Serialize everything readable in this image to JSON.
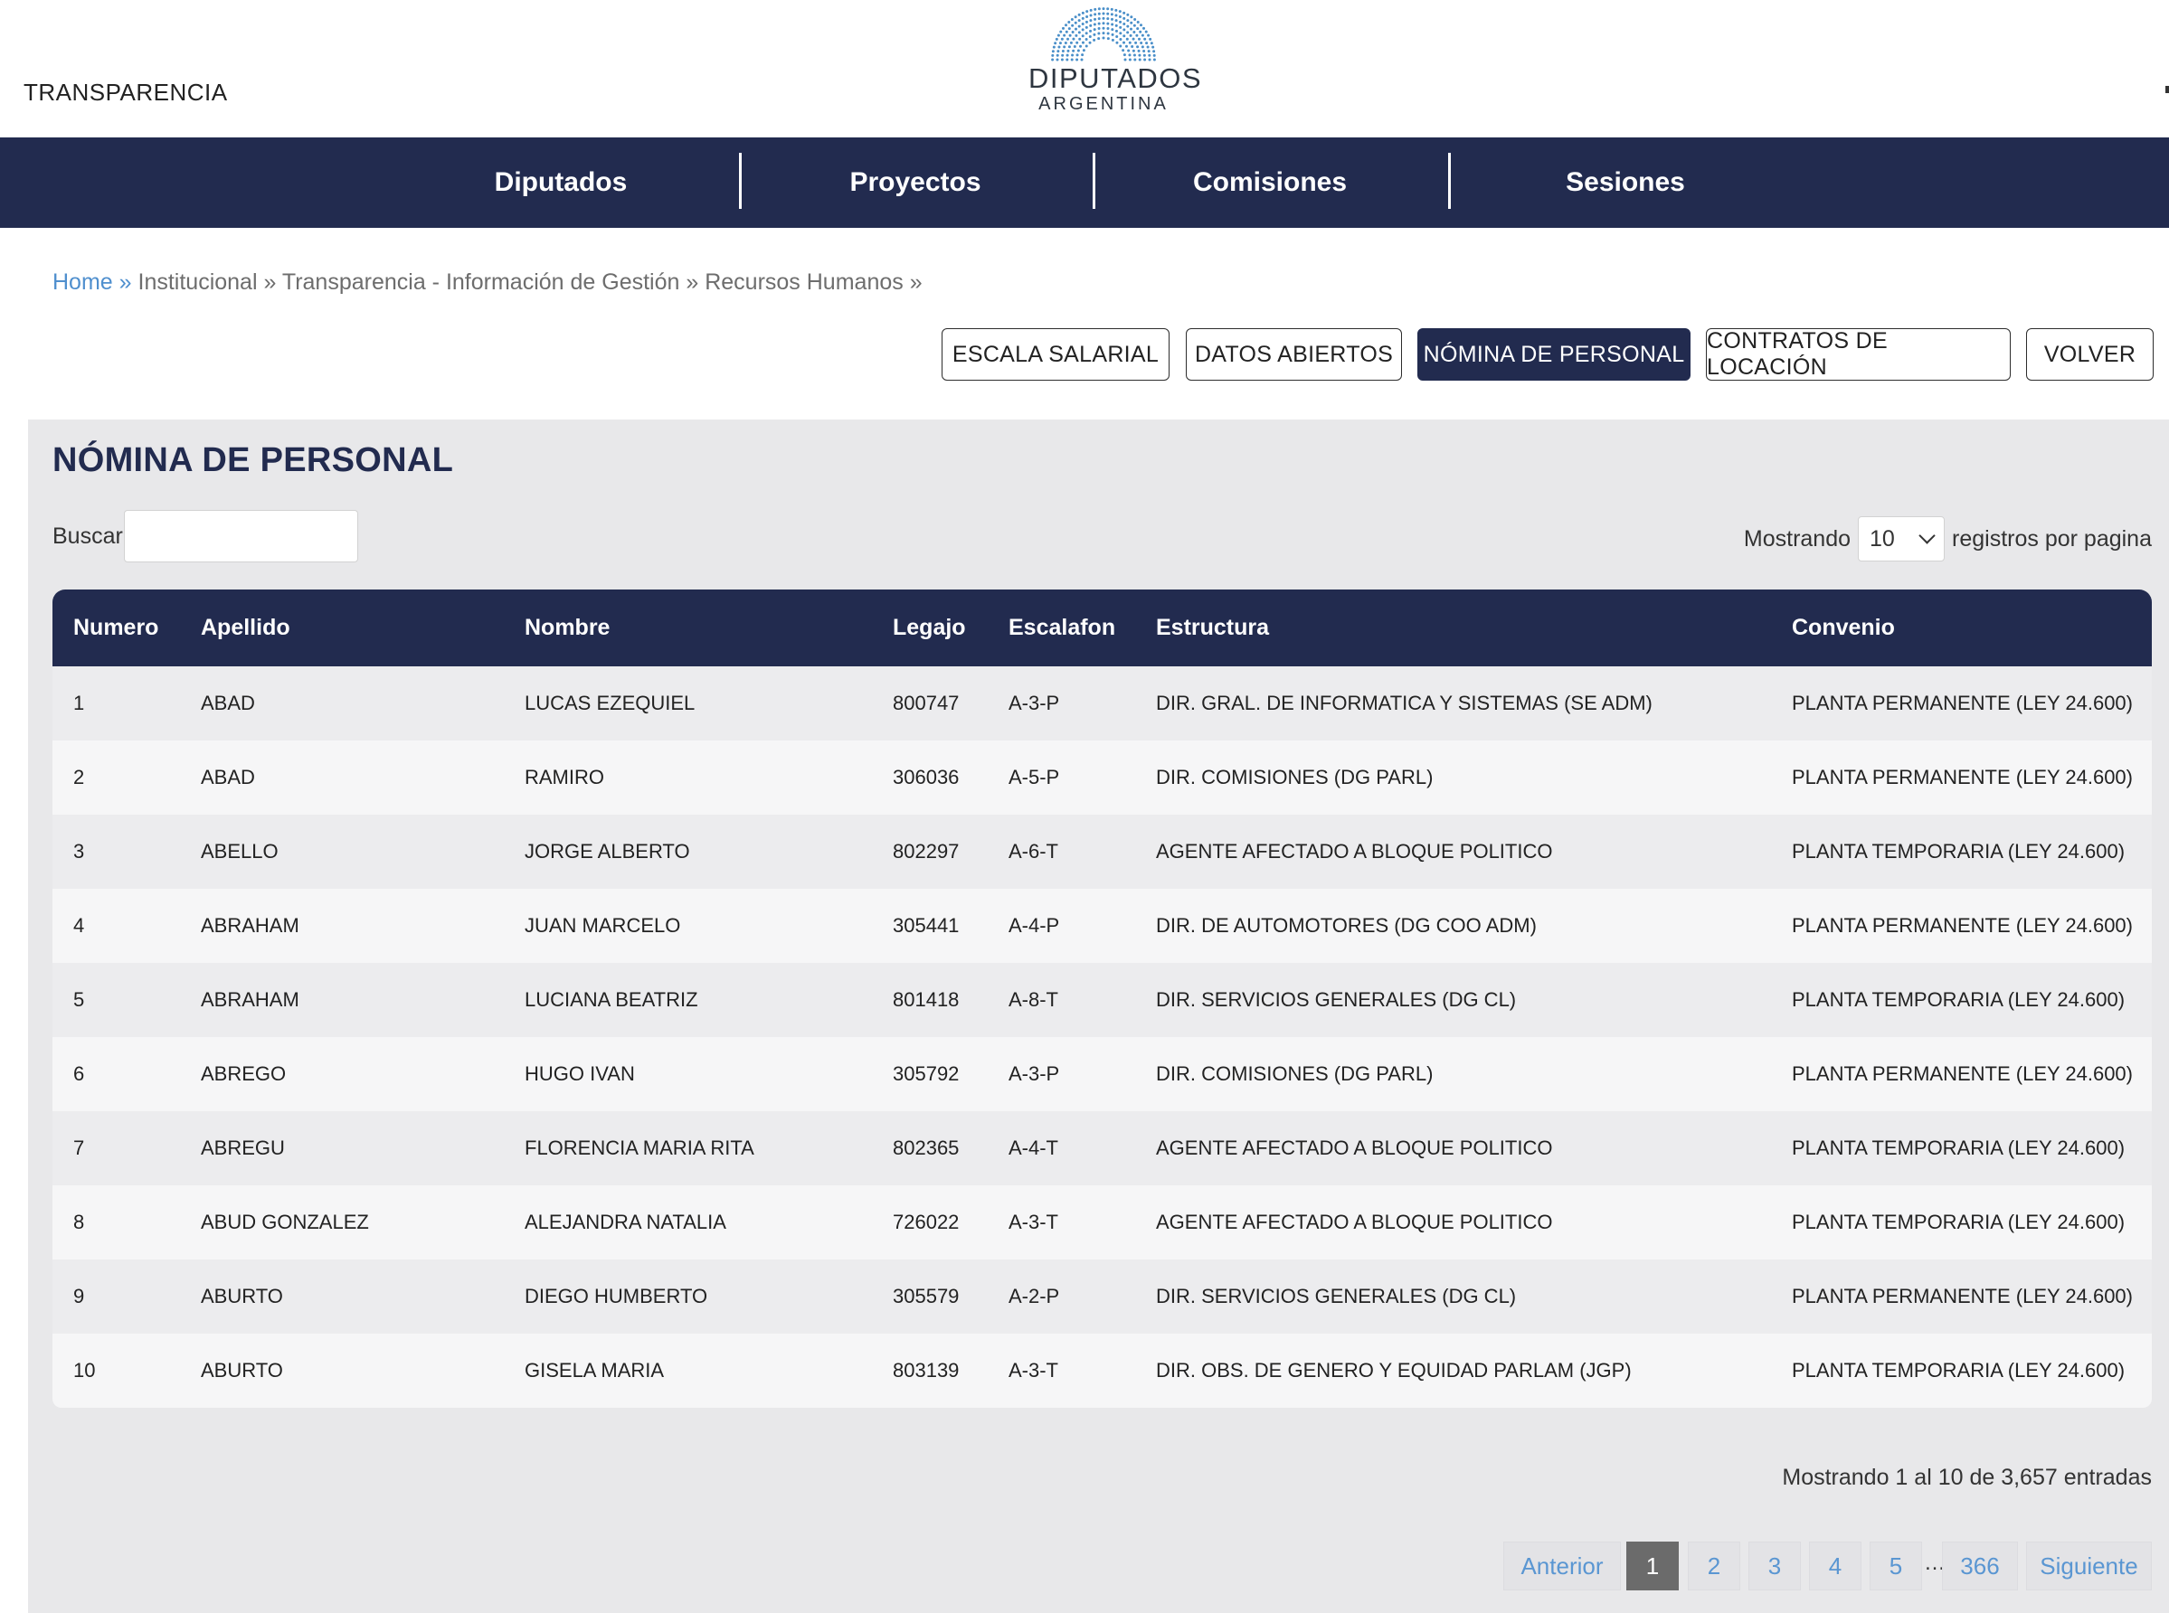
{
  "header": {
    "section_label": "TRANSPARENCIA",
    "logo_name": "DIPUTADOS",
    "logo_country": "ARGENTINA",
    "logo_icon": "hemicycle-seats-icon"
  },
  "nav": {
    "items": [
      "Diputados",
      "Proyectos",
      "Comisiones",
      "Sesiones"
    ]
  },
  "breadcrumb": {
    "home": "Home »",
    "rest": " Institucional » Transparencia - Información de Gestión » Recursos Humanos »"
  },
  "actions": {
    "escala": "ESCALA SALARIAL",
    "datos": "DATOS ABIERTOS",
    "nomina": "NÓMINA DE PERSONAL",
    "contratos": "CONTRATOS DE LOCACIÓN",
    "volver": "VOLVER"
  },
  "panel": {
    "title": "NÓMINA DE PERSONAL",
    "search_label": "Buscar:",
    "search_value": "",
    "length_prefix": "Mostrando",
    "length_value": "10",
    "length_suffix": "registros por pagina"
  },
  "table": {
    "columns": [
      "Numero",
      "Apellido",
      "Nombre",
      "Legajo",
      "Escalafon",
      "Estructura",
      "Convenio"
    ],
    "rows": [
      [
        "1",
        "ABAD",
        "LUCAS EZEQUIEL",
        "800747",
        "A-3-P",
        "DIR. GRAL. DE INFORMATICA Y SISTEMAS (SE ADM)",
        "PLANTA PERMANENTE (LEY 24.600)"
      ],
      [
        "2",
        "ABAD",
        "RAMIRO",
        "306036",
        "A-5-P",
        "DIR. COMISIONES (DG PARL)",
        "PLANTA PERMANENTE (LEY 24.600)"
      ],
      [
        "3",
        "ABELLO",
        "JORGE ALBERTO",
        "802297",
        "A-6-T",
        "AGENTE AFECTADO A BLOQUE POLITICO",
        "PLANTA TEMPORARIA (LEY 24.600)"
      ],
      [
        "4",
        "ABRAHAM",
        "JUAN MARCELO",
        "305441",
        "A-4-P",
        "DIR. DE AUTOMOTORES (DG COO ADM)",
        "PLANTA PERMANENTE (LEY 24.600)"
      ],
      [
        "5",
        "ABRAHAM",
        "LUCIANA BEATRIZ",
        "801418",
        "A-8-T",
        "DIR. SERVICIOS GENERALES (DG CL)",
        "PLANTA TEMPORARIA (LEY 24.600)"
      ],
      [
        "6",
        "ABREGO",
        "HUGO IVAN",
        "305792",
        "A-3-P",
        "DIR. COMISIONES (DG PARL)",
        "PLANTA PERMANENTE (LEY 24.600)"
      ],
      [
        "7",
        "ABREGU",
        "FLORENCIA MARIA RITA",
        "802365",
        "A-4-T",
        "AGENTE AFECTADO A BLOQUE POLITICO",
        "PLANTA TEMPORARIA (LEY 24.600)"
      ],
      [
        "8",
        "ABUD GONZALEZ",
        "ALEJANDRA NATALIA",
        "726022",
        "A-3-T",
        "AGENTE AFECTADO A BLOQUE POLITICO",
        "PLANTA TEMPORARIA (LEY 24.600)"
      ],
      [
        "9",
        "ABURTO",
        "DIEGO HUMBERTO",
        "305579",
        "A-2-P",
        "DIR. SERVICIOS GENERALES (DG CL)",
        "PLANTA PERMANENTE (LEY 24.600)"
      ],
      [
        "10",
        "ABURTO",
        "GISELA MARIA",
        "803139",
        "A-3-T",
        "DIR. OBS. DE GENERO Y EQUIDAD PARLAM (JGP)",
        "PLANTA TEMPORARIA (LEY 24.600)"
      ]
    ]
  },
  "info": "Mostrando 1 al 10 de 3,657 entradas",
  "pagination": {
    "prev": "Anterior",
    "pages": [
      "1",
      "2",
      "3",
      "4",
      "5"
    ],
    "ellipsis": "…",
    "last": "366",
    "next": "Siguiente",
    "current": "1"
  },
  "colors": {
    "navy": "#222b4f",
    "link": "#4f8fce",
    "panel_bg": "#e8e8ea"
  }
}
